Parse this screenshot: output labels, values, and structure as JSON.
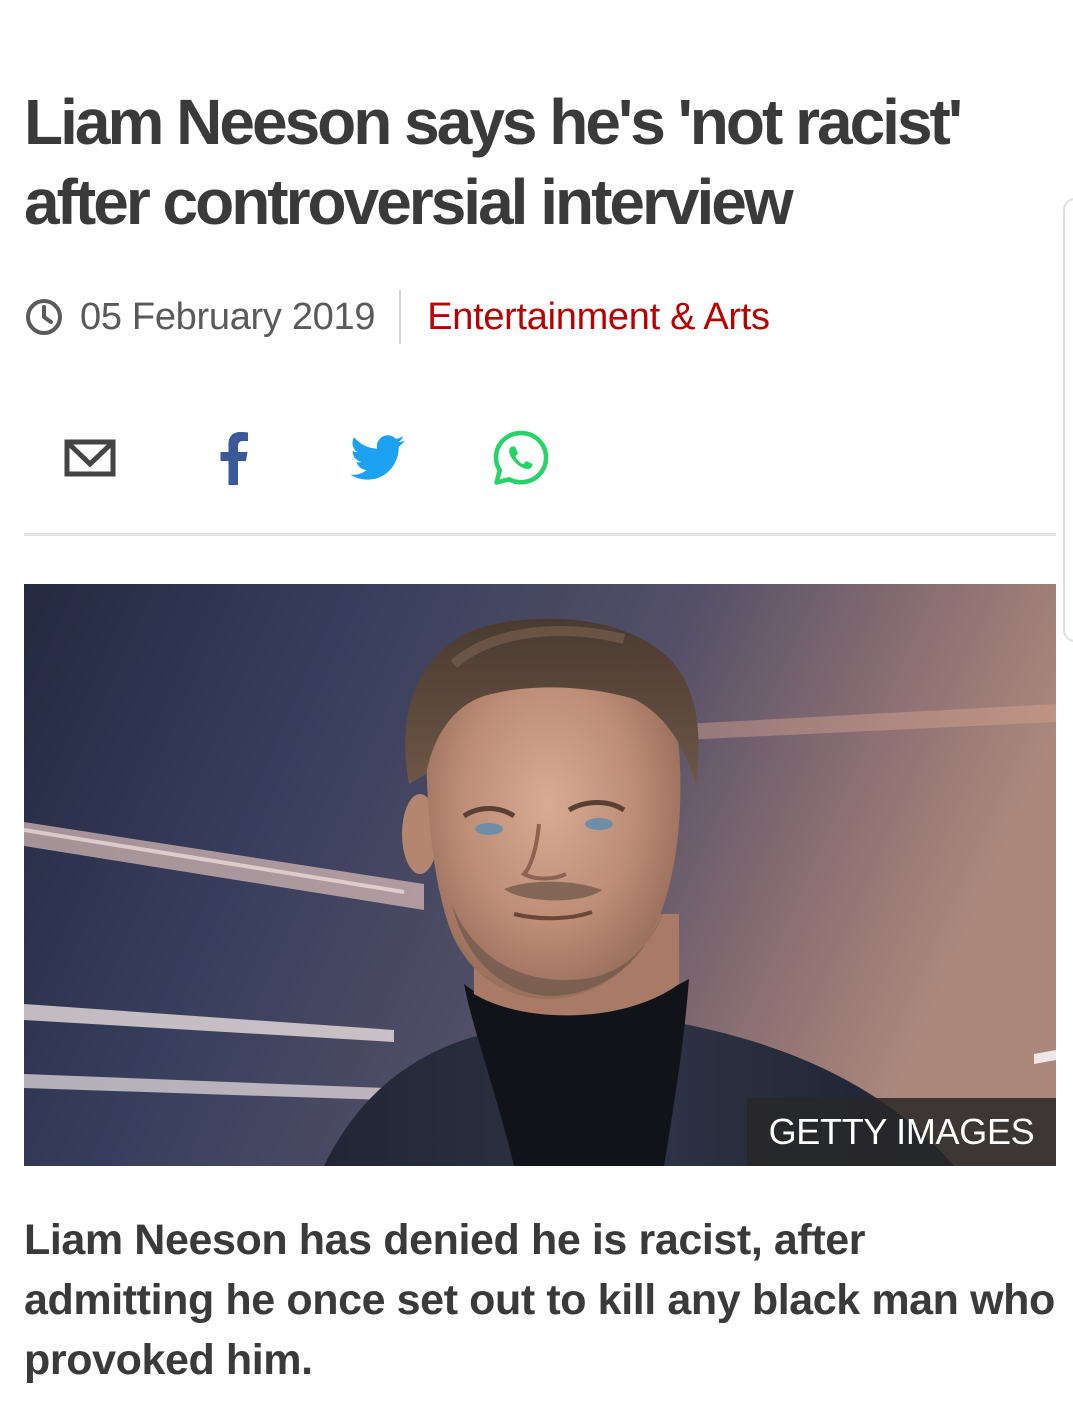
{
  "article": {
    "headline": "Liam Neeson says he's 'not racist' after controversial interview",
    "date": "05 February 2019",
    "category": "Entertainment & Arts",
    "image_credit": "GETTY IMAGES",
    "summary": "Liam Neeson has denied he is racist, after admitting he once set out to kill any black man who provoked him."
  },
  "icons": {
    "clock": "clock-icon",
    "email": "email-icon",
    "facebook": "facebook-icon",
    "twitter": "twitter-icon",
    "whatsapp": "whatsapp-icon"
  },
  "colors": {
    "headline": "#3a3a3a",
    "category": "#b80000",
    "facebook": "#3b5998",
    "twitter": "#1da1f2",
    "whatsapp": "#25d366",
    "credit_bg": "#282828"
  }
}
